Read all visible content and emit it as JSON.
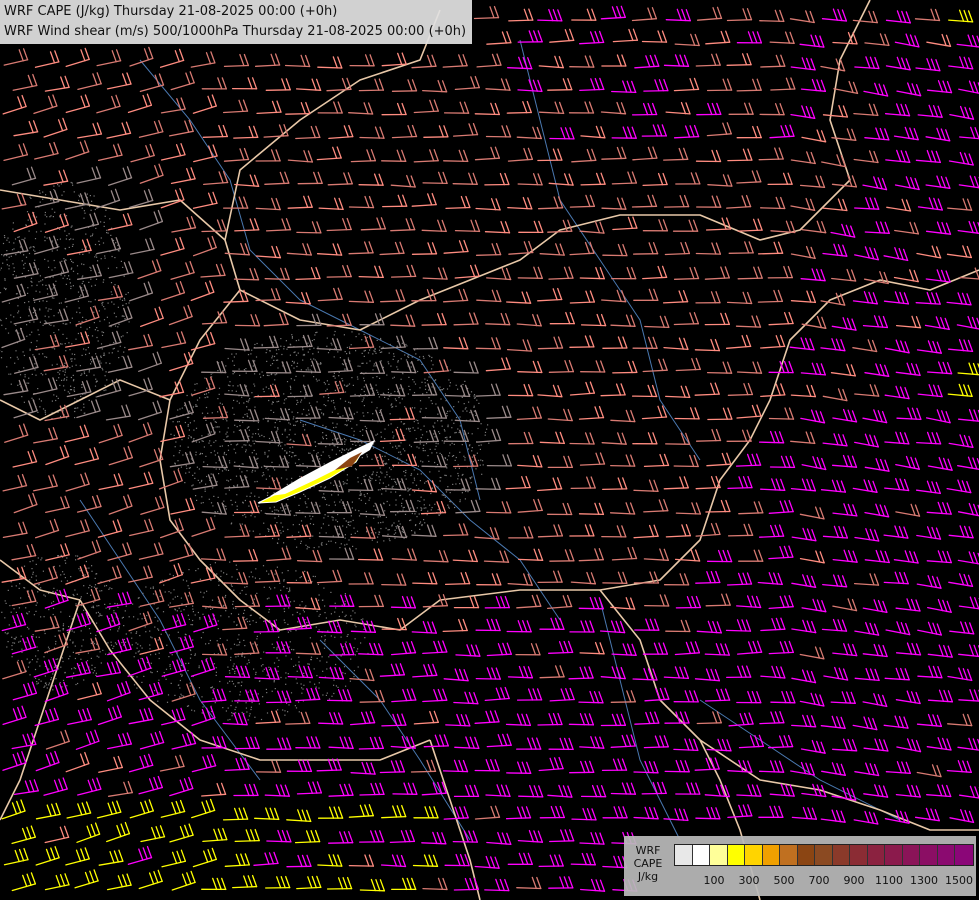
{
  "title": {
    "line1": "WRF CAPE (J/kg) Thursday 21-08-2025 00:00 (+0h)",
    "line2": "WRF Wind shear (m/s) 500/1000hPa Thursday 21-08-2025 00:00 (+0h)"
  },
  "legend": {
    "labels": [
      "WRF",
      "CAPE",
      "J/kg"
    ],
    "colors": [
      "#e8e8e8",
      "#ffffff",
      "#ffff99",
      "#ffff00",
      "#ffd400",
      "#f0a000",
      "#c07020",
      "#8b4513",
      "#8b4a22",
      "#8b3a2a",
      "#8b2c34",
      "#8b2240",
      "#8b1a4c",
      "#8b1458",
      "#8b0e64",
      "#8b0a70",
      "#8b0678"
    ],
    "ticks": [
      "100",
      "300",
      "500",
      "700",
      "900",
      "1100",
      "1300",
      "1500"
    ]
  },
  "map": {
    "background": "#000000",
    "barb_colors": {
      "low": "#d87a72",
      "mid": "#ff8c80",
      "high": "#ff00ff",
      "very_high": "#ffff00",
      "faded": "#9a8a8a"
    },
    "border_color": "#e8c8a8",
    "river_color": "#4a78b0",
    "cape_patch_colors": [
      "#ffffff",
      "#ffff00",
      "#8b4513"
    ]
  }
}
